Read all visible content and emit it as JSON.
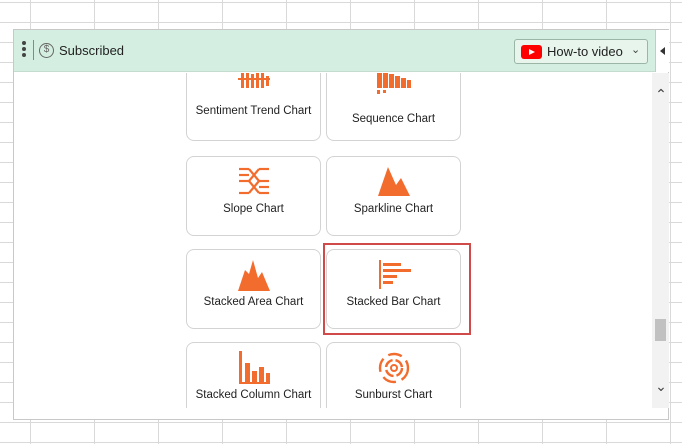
{
  "header": {
    "status_label": "Subscribed",
    "status_icon": "dollar-circle-icon",
    "howto_label": "How-to video",
    "howto_icon": "youtube-icon"
  },
  "tiles": [
    {
      "label": "Sentiment Trend Chart",
      "icon": "sentiment-trend-chart-icon"
    },
    {
      "label": "Sequence Chart",
      "icon": "sequence-chart-icon"
    },
    {
      "label": "Slope Chart",
      "icon": "slope-chart-icon"
    },
    {
      "label": "Sparkline Chart",
      "icon": "sparkline-chart-icon"
    },
    {
      "label": "Stacked Area Chart",
      "icon": "stacked-area-chart-icon"
    },
    {
      "label": "Stacked Bar Chart",
      "icon": "stacked-bar-chart-icon"
    },
    {
      "label": "Stacked Column Chart",
      "icon": "stacked-column-chart-icon"
    },
    {
      "label": "Sunburst Chart",
      "icon": "sunburst-chart-icon"
    }
  ],
  "colors": {
    "accent": "#f26c2e",
    "header_bg": "#d4efe1",
    "highlight": "#d04a4a"
  }
}
